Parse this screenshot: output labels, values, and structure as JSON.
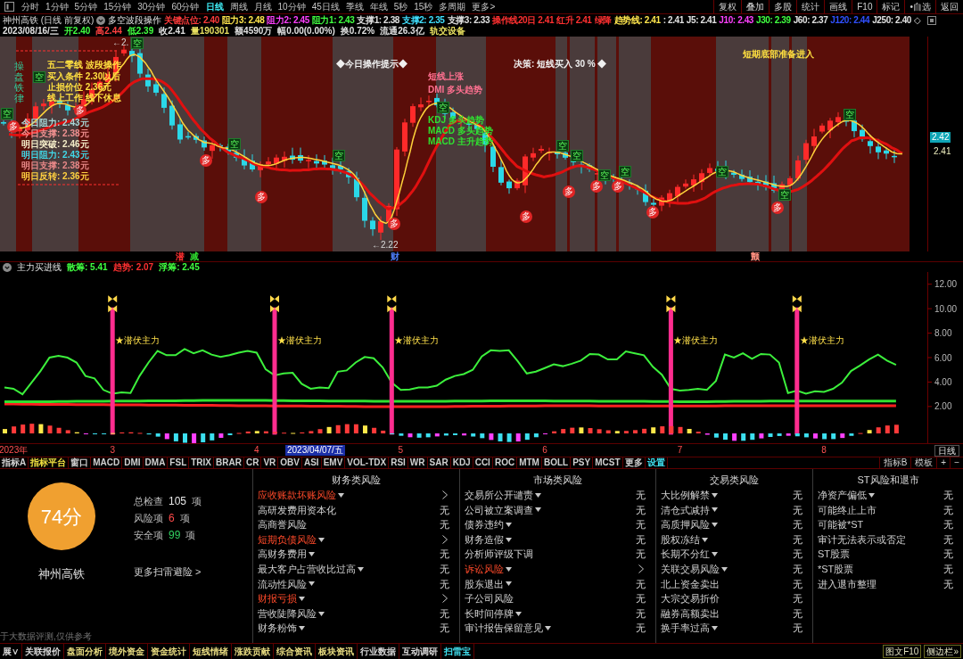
{
  "top_toolbar": {
    "period_tabs": [
      {
        "label": "分时",
        "selected": false
      },
      {
        "label": "1分钟",
        "selected": false
      },
      {
        "label": "5分钟",
        "selected": false
      },
      {
        "label": "15分钟",
        "selected": false
      },
      {
        "label": "30分钟",
        "selected": false
      },
      {
        "label": "60分钟",
        "selected": false
      },
      {
        "label": "日线",
        "selected": true
      },
      {
        "label": "周线",
        "selected": false
      },
      {
        "label": "月线",
        "selected": false
      },
      {
        "label": "10分钟",
        "selected": false
      },
      {
        "label": "45日线",
        "selected": false
      },
      {
        "label": "季线",
        "selected": false
      },
      {
        "label": "年线",
        "selected": false
      },
      {
        "label": "5秒",
        "selected": false
      },
      {
        "label": "15秒",
        "selected": false
      },
      {
        "label": "多周期",
        "selected": false
      },
      {
        "label": "更多>",
        "selected": false
      }
    ],
    "buttons": [
      "复权",
      "叠加",
      "多股",
      "统计",
      "画线",
      "F10",
      "标记",
      "•自选",
      "返回"
    ]
  },
  "quote_header": {
    "title": "神州高铁 (日线 前复权)",
    "indicator": "多空波段操作",
    "levels": [
      {
        "text": "关键点位: 2.40",
        "color": "#ff3b3b"
      },
      {
        "text": "阻力3: 2.48",
        "color": "#ffe64d"
      },
      {
        "text": "阻力2: 2.45",
        "color": "#ff40ff"
      },
      {
        "text": "阻力1: 2.43",
        "color": "#40ff40"
      },
      {
        "text": "支撑1: 2.38",
        "color": "#e0e0e0"
      },
      {
        "text": "支撑2: 2.35",
        "color": "#40e0ff"
      },
      {
        "text": "支撑3: 2.33",
        "color": "#e0e0e0"
      },
      {
        "text": "操作线20日 2.41",
        "color": "#ff3030"
      },
      {
        "text": "红升 2.41",
        "color": "#ff3030"
      },
      {
        "text": "绿降",
        "color": "#ff3030"
      },
      {
        "text": "趋势线: 2.41",
        "color": "#ffe64d"
      },
      {
        "text": ": 2.41",
        "color": "#e0e0e0"
      },
      {
        "text": "J5: 2.41",
        "color": "#e0e0e0"
      },
      {
        "text": "J10: 2.43",
        "color": "#ff40ff"
      },
      {
        "text": "J30: 2.39",
        "color": "#40ff40"
      },
      {
        "text": "J60: 2.37",
        "color": "#e0e0e0"
      },
      {
        "text": "J120: 2.44",
        "color": "#3050ff"
      },
      {
        "text": "J250: 2.40",
        "color": "#e0e0e0"
      }
    ],
    "end_mark": "◇"
  },
  "quote_line": [
    {
      "text": "2023/08/16/三",
      "color": "#e0e0e0"
    },
    {
      "text": "开2.40",
      "color": "#40ff40"
    },
    {
      "text": "高2.44",
      "color": "#ff4040"
    },
    {
      "text": "低2.39",
      "color": "#40ff40"
    },
    {
      "text": "收2.41",
      "color": "#e0e0e0"
    },
    {
      "text": "量190301",
      "color": "#e8e060"
    },
    {
      "text": "额4590万",
      "color": "#e0e0e0"
    },
    {
      "text": "幅0.00(0.00%)",
      "color": "#e0e0e0"
    },
    {
      "text": "换0.72%",
      "color": "#e0e0e0"
    },
    {
      "text": "流通26.3亿",
      "color": "#e0e0e0"
    },
    {
      "text": "轨交设备",
      "color": "#e8e060"
    }
  ],
  "main_chart": {
    "vertical_text": "操盘铁律",
    "overlay_texts": [
      {
        "text": "五二零线 波段操作",
        "color": "#ffe040"
      },
      {
        "text": "买入条件 2.30以后",
        "color": "#ffe040"
      },
      {
        "text": "止损价位 2.36元",
        "color": "#ffe040"
      },
      {
        "text": "线上工作 线下休息",
        "color": "#ffe040"
      },
      {
        "text": "今日阻力: 2.43元",
        "color": "#a8d8d8"
      },
      {
        "text": "今日支撑: 2.38元",
        "color": "#f09090"
      },
      {
        "text": "明日突破: 2.46元",
        "color": "#f4ecc8"
      },
      {
        "text": "明日阻力: 2.43元",
        "color": "#40d8e8"
      },
      {
        "text": "明日支撑: 2.38元",
        "color": "#e88888"
      },
      {
        "text": "明日反转: 2.36元",
        "color": "#ffd040"
      },
      {
        "text": "◆今日操作提示◆",
        "color": "#f0f0f0"
      },
      {
        "text": "短线上涨",
        "color": "#ff7090"
      },
      {
        "text": "DMI 多头趋势",
        "color": "#ff7090"
      },
      {
        "text": "KDJ 多头趋势",
        "color": "#30e030"
      },
      {
        "text": "MACD 多头趋势",
        "color": "#30e030"
      },
      {
        "text": "MACD 主升趋势",
        "color": "#30e030"
      },
      {
        "text": "决策: 短线买入 30 % ◆",
        "color": "#f0f0f0"
      },
      {
        "text": "短期底部准备进入",
        "color": "#ffe040"
      }
    ],
    "signals": [
      {
        "kind": "short",
        "label": "空"
      },
      {
        "kind": "long",
        "label": "多"
      },
      {
        "kind": "short",
        "label": "空"
      },
      {
        "kind": "long",
        "label": "多"
      },
      {
        "kind": "short",
        "label": "空"
      },
      {
        "kind": "long",
        "label": "多"
      },
      {
        "kind": "short",
        "label": "空"
      },
      {
        "kind": "long",
        "label": "多"
      },
      {
        "kind": "short",
        "label": "空"
      },
      {
        "kind": "long",
        "label": "多"
      },
      {
        "kind": "short",
        "label": "空"
      },
      {
        "kind": "long",
        "label": "多"
      },
      {
        "kind": "short",
        "label": "空"
      },
      {
        "kind": "long",
        "label": "多"
      },
      {
        "kind": "short",
        "label": "空"
      },
      {
        "kind": "long",
        "label": "多"
      },
      {
        "kind": "short",
        "label": "空"
      },
      {
        "kind": "long",
        "label": "多"
      },
      {
        "kind": "short",
        "label": "空"
      },
      {
        "kind": "long",
        "label": "多"
      },
      {
        "kind": "short",
        "label": "空"
      },
      {
        "kind": "long",
        "label": "多"
      },
      {
        "kind": "short",
        "label": "空"
      },
      {
        "kind": "short",
        "label": "空"
      }
    ],
    "extreme_labels": [
      "←2.",
      "←2.22"
    ],
    "price_labels": [
      {
        "text": "2.42",
        "kind": "current"
      },
      {
        "text": "2.41",
        "kind": "plain"
      }
    ]
  },
  "event_markers": [
    {
      "text": "潜",
      "color": "#ff3030"
    },
    {
      "text": "减",
      "color": "#30e030"
    },
    {
      "text": "财",
      "color": "#5080ff"
    },
    {
      "text": "颤",
      "color": "#ff9080"
    }
  ],
  "indicator": {
    "readings": [
      {
        "text": "散筹: 5.41",
        "color": "#40ff40"
      },
      {
        "text": "趋势: 2.07",
        "color": "#ff3030"
      },
      {
        "text": "浮筹: 2.45",
        "color": "#40ff40"
      }
    ],
    "cursor_date": "2023/04/07/五",
    "period": "日线",
    "chart_data": {
      "type": "line",
      "title": "主力买进线",
      "categories": [
        null,
        "2023年",
        null,
        null,
        null,
        null,
        null,
        null,
        null,
        null,
        null,
        null,
        "3",
        null,
        null,
        null,
        null,
        null,
        null,
        null,
        null,
        null,
        null,
        null,
        null,
        null,
        null,
        null,
        "4",
        null,
        null,
        null,
        null,
        null,
        null,
        null,
        null,
        null,
        null,
        null,
        null,
        null,
        null,
        null,
        "5",
        null,
        null,
        null,
        null,
        null,
        null,
        null,
        null,
        null,
        null,
        null,
        null,
        null,
        null,
        null,
        "6",
        null,
        null,
        null,
        null,
        null,
        null,
        null,
        null,
        null,
        null,
        null,
        null,
        null,
        null,
        "7",
        null,
        null,
        null,
        null,
        null,
        null,
        null,
        null,
        null,
        null,
        null,
        null,
        null,
        null,
        null,
        "8",
        null,
        null,
        null,
        null,
        null,
        null,
        null,
        null
      ],
      "series": [
        {
          "color": "#3cf03c",
          "values": [
            3.55,
            3.45,
            3.0,
            3.95,
            4.9,
            6.0,
            6.15,
            6.0,
            5.6,
            4.5,
            4.3,
            3.35,
            3.05,
            3.15,
            3.1,
            4.5,
            5.6,
            6.55,
            6.2,
            6.2,
            6.7,
            6.35,
            6.6,
            6.25,
            6.05,
            6.2,
            6.4,
            6.55,
            6.4,
            5.05,
            4.55,
            4.7,
            4.75,
            3.85,
            3.45,
            3.55,
            3.5,
            4.85,
            4.95,
            5.6,
            6.05,
            5.95,
            5.2,
            3.95,
            3.35,
            3.4,
            3.55,
            3.55,
            3.7,
            4.2,
            4.5,
            4.65,
            5.0,
            6.1,
            6.6,
            6.55,
            6.6,
            5.7,
            4.7,
            4.85,
            5.15,
            5.45,
            5.3,
            5.5,
            5.75,
            6.3,
            6.25,
            5.85,
            5.85,
            6.5,
            6.35,
            6.2,
            5.25,
            4.6,
            3.45,
            3.3,
            3.35,
            3.45,
            3.35,
            4.1,
            6.25,
            6.0,
            6.35,
            5.9,
            6.3,
            6.25,
            5.6,
            3.1,
            3.3,
            3.05,
            3.25,
            3.2,
            3.45,
            3.95,
            4.9,
            5.35,
            5.85,
            6.25,
            5.75,
            5.41
          ]
        },
        {
          "color": "#ff2020",
          "values": [
            2.2,
            2.2,
            2.19,
            2.19,
            2.18,
            2.18,
            2.17,
            2.17,
            2.16,
            2.16,
            2.15,
            2.15,
            2.14,
            2.14,
            2.13,
            2.13,
            2.12,
            2.12,
            2.11,
            2.11,
            2.1,
            2.1,
            2.09,
            2.09,
            2.08,
            2.08,
            2.07,
            2.07,
            2.06,
            2.06,
            2.05,
            2.05,
            2.04,
            2.04,
            2.03,
            2.03,
            2.02,
            2.02,
            2.01,
            2.01,
            2.0,
            2.0,
            2.0,
            2.0,
            2.0,
            2.0,
            2.0,
            2.0,
            2.0,
            2.0,
            2.01,
            2.01,
            2.02,
            2.02,
            2.03,
            2.03,
            2.04,
            2.04,
            2.05,
            2.05,
            2.06,
            2.06,
            2.06,
            2.06,
            2.06,
            2.06,
            2.05,
            2.05,
            2.05,
            2.05,
            2.04,
            2.04,
            2.04,
            2.04,
            2.04,
            2.04,
            2.05,
            2.05,
            2.05,
            2.05,
            2.06,
            2.06,
            2.06,
            2.06,
            2.06,
            2.06,
            2.07,
            2.07,
            2.07,
            2.07,
            2.07,
            2.07,
            2.07,
            2.07,
            2.07,
            2.07,
            2.07,
            2.07,
            2.07,
            2.07
          ]
        },
        {
          "color": "#30e030",
          "values": [
            2.38,
            2.38,
            2.39,
            2.39,
            2.4,
            2.4,
            2.41,
            2.41,
            2.42,
            2.42,
            2.43,
            2.43,
            2.44,
            2.44,
            2.45,
            2.45,
            2.46,
            2.46,
            2.47,
            2.47,
            2.48,
            2.48,
            2.49,
            2.49,
            2.5,
            2.5,
            2.5,
            2.5,
            2.49,
            2.49,
            2.48,
            2.48,
            2.47,
            2.47,
            2.46,
            2.46,
            2.45,
            2.45,
            2.44,
            2.44,
            2.44,
            2.43,
            2.43,
            2.43,
            2.42,
            2.42,
            2.42,
            2.42,
            2.43,
            2.43,
            2.44,
            2.44,
            2.45,
            2.45,
            2.46,
            2.46,
            2.47,
            2.47,
            2.47,
            2.46,
            2.46,
            2.45,
            2.45,
            2.44,
            2.44,
            2.44,
            2.43,
            2.43,
            2.43,
            2.42,
            2.42,
            2.42,
            2.41,
            2.41,
            2.41,
            2.4,
            2.4,
            2.4,
            2.4,
            2.41,
            2.41,
            2.42,
            2.42,
            2.43,
            2.43,
            2.44,
            2.44,
            2.44,
            2.44,
            2.45,
            2.45,
            2.45,
            2.45,
            2.45,
            2.45,
            2.45,
            2.45,
            2.45,
            2.45,
            2.45
          ]
        }
      ],
      "ylim": [
        -1,
        13
      ],
      "yticks": [
        {
          "value": 2,
          "label": "2.00"
        },
        {
          "value": 4,
          "label": "4.00"
        },
        {
          "value": 6,
          "label": "6.00"
        },
        {
          "value": 8,
          "label": "8.00"
        },
        {
          "value": 10,
          "label": "10.00"
        },
        {
          "value": 12,
          "label": "12.00"
        }
      ],
      "annotations": [
        "★潜伏主力",
        "★潜伏主力",
        "★潜伏主力",
        "★潜伏主力",
        "★潜伏主力"
      ]
    }
  },
  "indicator_tabs": {
    "left": [
      {
        "label": "指标A",
        "color": "#d0d0d0"
      },
      {
        "label": "指标平台",
        "color": "#f0e040"
      },
      {
        "label": "窗口",
        "color": "#d0d0d0"
      },
      {
        "label": "MACD",
        "color": "#d0d0d0"
      },
      {
        "label": "DMI",
        "color": "#d0d0d0"
      },
      {
        "label": "DMA",
        "color": "#d0d0d0"
      },
      {
        "label": "FSL",
        "color": "#d0d0d0"
      },
      {
        "label": "TRIX",
        "color": "#d0d0d0"
      },
      {
        "label": "BRAR",
        "color": "#d0d0d0"
      },
      {
        "label": "CR",
        "color": "#d0d0d0"
      },
      {
        "label": "VR",
        "color": "#d0d0d0"
      },
      {
        "label": "OBV",
        "color": "#d0d0d0"
      },
      {
        "label": "ASI",
        "color": "#d0d0d0"
      },
      {
        "label": "EMV",
        "color": "#d0d0d0"
      },
      {
        "label": "VOL-TDX",
        "color": "#d0d0d0"
      },
      {
        "label": "RSI",
        "color": "#d0d0d0"
      },
      {
        "label": "WR",
        "color": "#d0d0d0"
      },
      {
        "label": "SAR",
        "color": "#d0d0d0"
      },
      {
        "label": "KDJ",
        "color": "#d0d0d0"
      },
      {
        "label": "CCI",
        "color": "#d0d0d0"
      },
      {
        "label": "ROC",
        "color": "#d0d0d0"
      },
      {
        "label": "MTM",
        "color": "#d0d0d0"
      },
      {
        "label": "BOLL",
        "color": "#d0d0d0"
      },
      {
        "label": "PSY",
        "color": "#d0d0d0"
      },
      {
        "label": "MCST",
        "color": "#d0d0d0"
      },
      {
        "label": "更多",
        "color": "#d0d0d0"
      },
      {
        "label": "设置",
        "color": "#40e0f0"
      }
    ],
    "right": [
      "指标B",
      "模板",
      "+",
      "−"
    ]
  },
  "scan": {
    "score": "74分",
    "stock": "神州高铁",
    "stats": [
      {
        "label": "总检查",
        "value": "105",
        "unit": "项",
        "kind": "total"
      },
      {
        "label": "风险项",
        "value": "6",
        "unit": "项",
        "kind": "risk"
      },
      {
        "label": "安全项",
        "value": "99",
        "unit": "项",
        "kind": "safe"
      }
    ],
    "more_link": "更多扫雷避险 >",
    "disclaimer": "于大数据评测,仅供参考",
    "categories": [
      {
        "title": "财务类风险",
        "items": [
          {
            "name": "应收账款坏账风险",
            "dropdown": true,
            "risk": true
          },
          {
            "name": "高研发费用资本化",
            "dropdown": false,
            "risk": false,
            "result": "无"
          },
          {
            "name": "高商誉风险",
            "dropdown": false,
            "risk": false,
            "result": "无"
          },
          {
            "name": "短期负债风险",
            "dropdown": true,
            "risk": true
          },
          {
            "name": "高财务费用",
            "dropdown": true,
            "risk": false,
            "result": "无"
          },
          {
            "name": "最大客户占营收比过高",
            "dropdown": true,
            "risk": false,
            "result": "无"
          },
          {
            "name": "流动性风险",
            "dropdown": true,
            "risk": false,
            "result": "无"
          },
          {
            "name": "财报亏损",
            "dropdown": true,
            "risk": true
          },
          {
            "name": "营收陡降风险",
            "dropdown": true,
            "risk": false,
            "result": "无"
          },
          {
            "name": "财务粉饰",
            "dropdown": true,
            "risk": false,
            "result": "无"
          }
        ]
      },
      {
        "title": "市场类风险",
        "items": [
          {
            "name": "交易所公开谴责",
            "dropdown": true,
            "risk": false,
            "result": "无"
          },
          {
            "name": "公司被立案调查",
            "dropdown": true,
            "risk": false,
            "result": "无"
          },
          {
            "name": "债券违约",
            "dropdown": true,
            "risk": false,
            "result": "无"
          },
          {
            "name": "财务造假",
            "dropdown": true,
            "risk": false,
            "result": "无"
          },
          {
            "name": "分析师评级下调",
            "dropdown": false,
            "risk": false,
            "result": "无"
          },
          {
            "name": "诉讼风险",
            "dropdown": true,
            "risk": true
          },
          {
            "name": "股东退出",
            "dropdown": true,
            "risk": false,
            "result": "无"
          },
          {
            "name": "子公司风险",
            "dropdown": false,
            "risk": false,
            "result": "无"
          },
          {
            "name": "长时间停牌",
            "dropdown": true,
            "risk": false,
            "result": "无"
          },
          {
            "name": "审计报告保留意见",
            "dropdown": true,
            "risk": false,
            "result": "无"
          }
        ]
      },
      {
        "title": "交易类风险",
        "items": [
          {
            "name": "大比例解禁",
            "dropdown": true,
            "risk": false,
            "result": "无"
          },
          {
            "name": "清仓式减持",
            "dropdown": true,
            "risk": false,
            "result": "无"
          },
          {
            "name": "高质押风险",
            "dropdown": true,
            "risk": false,
            "result": "无"
          },
          {
            "name": "股权冻结",
            "dropdown": true,
            "risk": false,
            "result": "无"
          },
          {
            "name": "长期不分红",
            "dropdown": true,
            "risk": false,
            "result": "无"
          },
          {
            "name": "关联交易风险",
            "dropdown": true,
            "risk": false,
            "result": "无"
          },
          {
            "name": "北上资金卖出",
            "dropdown": false,
            "risk": false,
            "result": "无"
          },
          {
            "name": "大宗交易折价",
            "dropdown": false,
            "risk": false,
            "result": "无"
          },
          {
            "name": "融券高额卖出",
            "dropdown": false,
            "risk": false,
            "result": "无"
          },
          {
            "name": "换手率过高",
            "dropdown": true,
            "risk": false,
            "result": "无"
          }
        ]
      },
      {
        "title": "ST风险和退市",
        "items": [
          {
            "name": "净资产偏低",
            "dropdown": true,
            "risk": false,
            "result": "无"
          },
          {
            "name": "可能终止上市",
            "dropdown": false,
            "risk": false,
            "result": "无"
          },
          {
            "name": "可能被*ST",
            "dropdown": false,
            "risk": false,
            "result": "无"
          },
          {
            "name": "审计无法表示或否定",
            "dropdown": false,
            "risk": false,
            "result": "无"
          },
          {
            "name": "ST股票",
            "dropdown": false,
            "risk": false,
            "result": "无"
          },
          {
            "name": "*ST股票",
            "dropdown": false,
            "risk": false,
            "result": "无"
          },
          {
            "name": "进入退市整理",
            "dropdown": false,
            "risk": false,
            "result": "无"
          }
        ]
      }
    ]
  },
  "bottom_tabs": [
    {
      "label": "展∨",
      "color": "#d8d8d8"
    },
    {
      "label": "关联报价",
      "color": "#d8d8d8"
    },
    {
      "label": "盘面分析",
      "color": "#e8dc80"
    },
    {
      "label": "境外资金",
      "color": "#e8dc80"
    },
    {
      "label": "资金统计",
      "color": "#e8dc80"
    },
    {
      "label": "短线情绪",
      "color": "#e8dc80"
    },
    {
      "label": "涨跌贡献",
      "color": "#e8dc80"
    },
    {
      "label": "综合资讯",
      "color": "#e8dc80"
    },
    {
      "label": "板块资讯",
      "color": "#e8dc80"
    },
    {
      "label": "行业数据",
      "color": "#d8d8d8"
    },
    {
      "label": "互动调研",
      "color": "#d8d8d8"
    },
    {
      "label": "扫雷宝",
      "color": "#40e0f0"
    }
  ],
  "bottom_right": [
    "图文F10",
    "侧边栏»"
  ]
}
